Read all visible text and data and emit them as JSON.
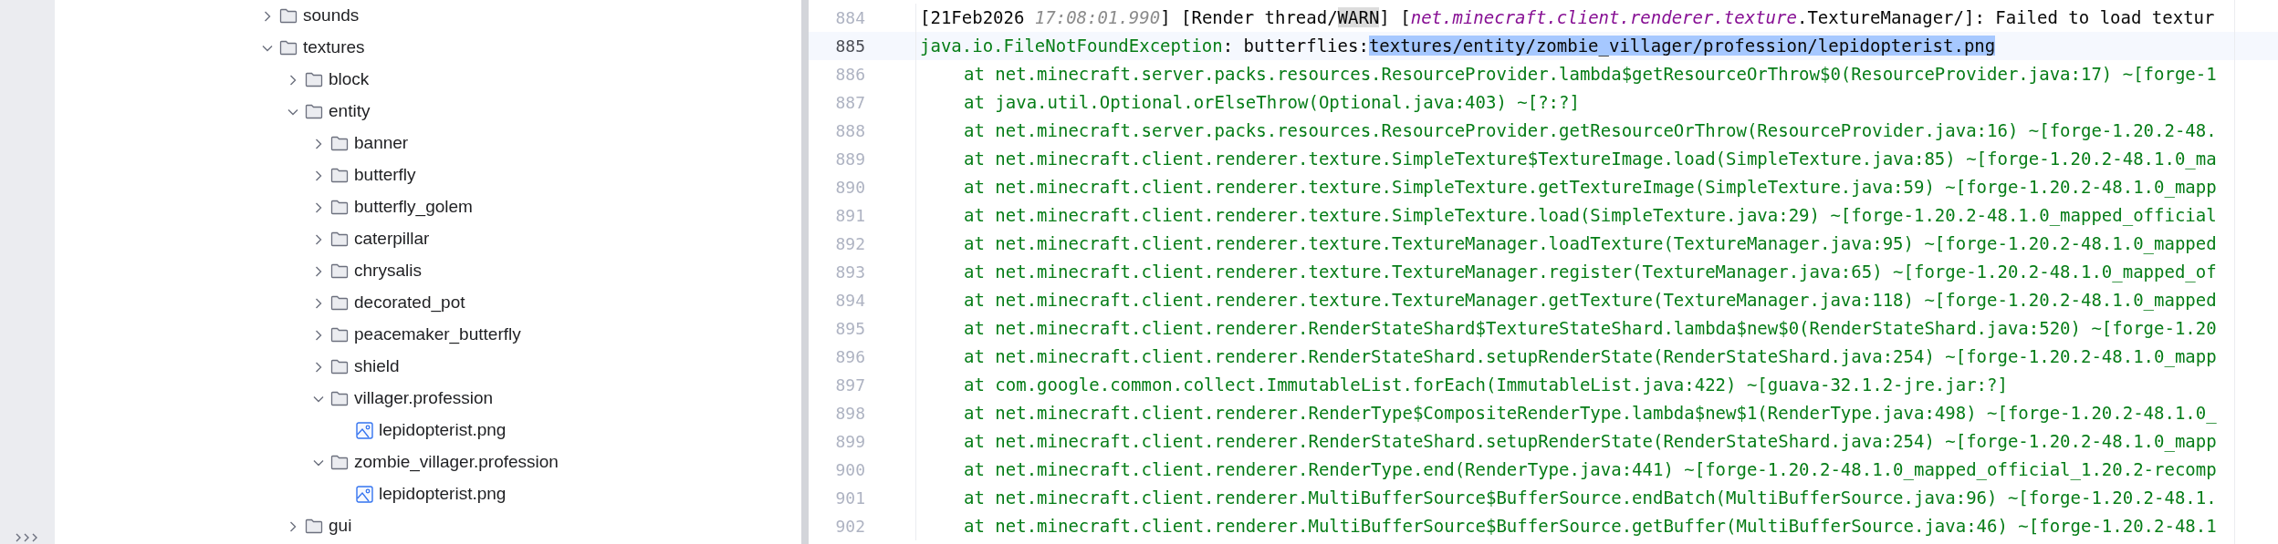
{
  "project_tree": {
    "items": [
      {
        "name": "sounds",
        "kind": "folder",
        "expanded": false
      },
      {
        "name": "textures",
        "kind": "folder",
        "expanded": true,
        "children": [
          {
            "name": "block",
            "kind": "folder",
            "expanded": false
          },
          {
            "name": "entity",
            "kind": "folder",
            "expanded": true,
            "children": [
              {
                "name": "banner",
                "kind": "folder",
                "expanded": false
              },
              {
                "name": "butterfly",
                "kind": "folder",
                "expanded": false
              },
              {
                "name": "butterfly_golem",
                "kind": "folder",
                "expanded": false
              },
              {
                "name": "caterpillar",
                "kind": "folder",
                "expanded": false
              },
              {
                "name": "chrysalis",
                "kind": "folder",
                "expanded": false
              },
              {
                "name": "decorated_pot",
                "kind": "folder",
                "expanded": false
              },
              {
                "name": "peacemaker_butterfly",
                "kind": "folder",
                "expanded": false
              },
              {
                "name": "shield",
                "kind": "folder",
                "expanded": false
              },
              {
                "name": "villager.profession",
                "kind": "folder",
                "expanded": true,
                "children": [
                  {
                    "name": "lepidopterist.png",
                    "kind": "image"
                  }
                ]
              },
              {
                "name": "zombie_villager.profession",
                "kind": "folder",
                "expanded": true,
                "children": [
                  {
                    "name": "lepidopterist.png",
                    "kind": "image"
                  }
                ]
              }
            ]
          },
          {
            "name": "gui",
            "kind": "folder",
            "expanded": false
          }
        ]
      }
    ]
  },
  "editor": {
    "lines": [
      {
        "number": "884",
        "current": false,
        "segments": [
          {
            "kind": "plain",
            "text": "[21Feb2026 "
          },
          {
            "kind": "timestamp",
            "text": "17:08:01.990"
          },
          {
            "kind": "plain",
            "text": "] [Render thread/"
          },
          {
            "kind": "level",
            "text": "WARN"
          },
          {
            "kind": "plain",
            "text": "] ["
          },
          {
            "kind": "logger",
            "text": "net.minecraft.client.renderer.texture"
          },
          {
            "kind": "plain",
            "text": ".TextureManager/]: Failed to load textur"
          }
        ]
      },
      {
        "number": "885",
        "current": true,
        "segments": [
          {
            "kind": "exception",
            "text": "java.io.FileNotFoundException"
          },
          {
            "kind": "plain",
            "text": ": butterflies:"
          },
          {
            "kind": "selection",
            "text": "textures/entity/zombie_villager/profession/lepidopterist.png"
          }
        ]
      },
      {
        "number": "886",
        "current": false,
        "segments": [
          {
            "kind": "trace",
            "text": "at net.minecraft.server.packs.resources.ResourceProvider.lambda$getResourceOrThrow$0(ResourceProvider.java:17) ~[forge-1"
          }
        ]
      },
      {
        "number": "887",
        "current": false,
        "segments": [
          {
            "kind": "trace",
            "text": "at java.util.Optional.orElseThrow(Optional.java:403) ~[?:?]"
          }
        ]
      },
      {
        "number": "888",
        "current": false,
        "segments": [
          {
            "kind": "trace",
            "text": "at net.minecraft.server.packs.resources.ResourceProvider.getResourceOrThrow(ResourceProvider.java:16) ~[forge-1.20.2-48."
          }
        ]
      },
      {
        "number": "889",
        "current": false,
        "segments": [
          {
            "kind": "trace",
            "text": "at net.minecraft.client.renderer.texture.SimpleTexture$TextureImage.load(SimpleTexture.java:85) ~[forge-1.20.2-48.1.0_ma"
          }
        ]
      },
      {
        "number": "890",
        "current": false,
        "segments": [
          {
            "kind": "trace",
            "text": "at net.minecraft.client.renderer.texture.SimpleTexture.getTextureImage(SimpleTexture.java:59) ~[forge-1.20.2-48.1.0_mapp"
          }
        ]
      },
      {
        "number": "891",
        "current": false,
        "segments": [
          {
            "kind": "trace",
            "text": "at net.minecraft.client.renderer.texture.SimpleTexture.load(SimpleTexture.java:29) ~[forge-1.20.2-48.1.0_mapped_official"
          }
        ]
      },
      {
        "number": "892",
        "current": false,
        "segments": [
          {
            "kind": "trace",
            "text": "at net.minecraft.client.renderer.texture.TextureManager.loadTexture(TextureManager.java:95) ~[forge-1.20.2-48.1.0_mapped"
          }
        ]
      },
      {
        "number": "893",
        "current": false,
        "segments": [
          {
            "kind": "trace",
            "text": "at net.minecraft.client.renderer.texture.TextureManager.register(TextureManager.java:65) ~[forge-1.20.2-48.1.0_mapped_of"
          }
        ]
      },
      {
        "number": "894",
        "current": false,
        "segments": [
          {
            "kind": "trace",
            "text": "at net.minecraft.client.renderer.texture.TextureManager.getTexture(TextureManager.java:118) ~[forge-1.20.2-48.1.0_mapped"
          }
        ]
      },
      {
        "number": "895",
        "current": false,
        "segments": [
          {
            "kind": "trace",
            "text": "at net.minecraft.client.renderer.RenderStateShard$TextureStateShard.lambda$new$0(RenderStateShard.java:520) ~[forge-1.20"
          }
        ]
      },
      {
        "number": "896",
        "current": false,
        "segments": [
          {
            "kind": "trace",
            "text": "at net.minecraft.client.renderer.RenderStateShard.setupRenderState(RenderStateShard.java:254) ~[forge-1.20.2-48.1.0_mapp"
          }
        ]
      },
      {
        "number": "897",
        "current": false,
        "segments": [
          {
            "kind": "trace",
            "text": "at com.google.common.collect.ImmutableList.forEach(ImmutableList.java:422) ~[guava-32.1.2-jre.jar:?]"
          }
        ]
      },
      {
        "number": "898",
        "current": false,
        "segments": [
          {
            "kind": "trace",
            "text": "at net.minecraft.client.renderer.RenderType$CompositeRenderType.lambda$new$1(RenderType.java:498) ~[forge-1.20.2-48.1.0_"
          }
        ]
      },
      {
        "number": "899",
        "current": false,
        "segments": [
          {
            "kind": "trace",
            "text": "at net.minecraft.client.renderer.RenderStateShard.setupRenderState(RenderStateShard.java:254) ~[forge-1.20.2-48.1.0_mapp"
          }
        ]
      },
      {
        "number": "900",
        "current": false,
        "segments": [
          {
            "kind": "trace",
            "text": "at net.minecraft.client.renderer.RenderType.end(RenderType.java:441) ~[forge-1.20.2-48.1.0_mapped_official_1.20.2-recomp"
          }
        ]
      },
      {
        "number": "901",
        "current": false,
        "segments": [
          {
            "kind": "trace",
            "text": "at net.minecraft.client.renderer.MultiBufferSource$BufferSource.endBatch(MultiBufferSource.java:96) ~[forge-1.20.2-48.1."
          }
        ]
      },
      {
        "number": "902",
        "current": false,
        "segments": [
          {
            "kind": "trace",
            "text": "at net.minecraft.client.renderer.MultiBufferSource$BufferSource.getBuffer(MultiBufferSource.java:46) ~[forge-1.20.2-48.1"
          }
        ]
      }
    ]
  }
}
